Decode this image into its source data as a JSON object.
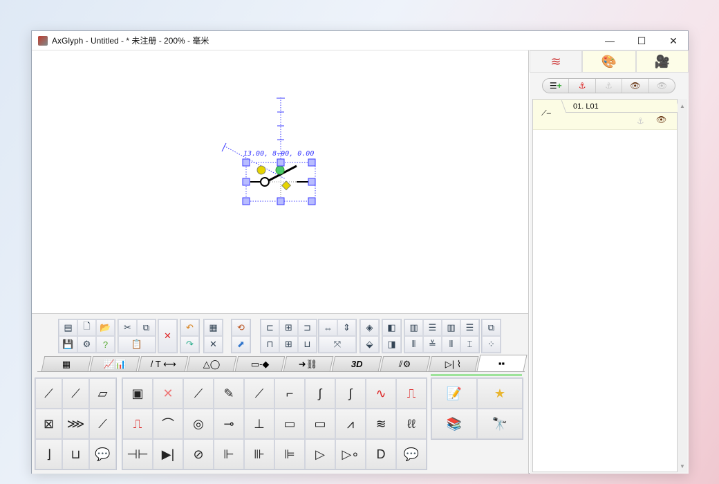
{
  "window": {
    "title": "AxGlyph - Untitled - * 未注册 - 200% - 毫米",
    "minimize": "—",
    "maximize": "☐",
    "close": "✕"
  },
  "canvas": {
    "coord_readout": "13.00, 8.00, 0.00"
  },
  "toolbar_groups": [
    {
      "cols": 3,
      "icons": [
        "view-options-icon",
        "new-document-icon",
        "open-folder-icon",
        "save-icon",
        "settings-gear-icon",
        "help-icon"
      ]
    },
    {
      "cols": 2,
      "icons": [
        "cut-icon",
        "copy-icon",
        "paste-icon"
      ]
    },
    {
      "cols": 1,
      "icons": [
        "delete-icon"
      ]
    },
    {
      "cols": 1,
      "icons": [
        "undo-icon",
        "redo-icon"
      ]
    },
    {
      "cols": 1,
      "icons": [
        "grid-snap-icon",
        "snap-point-icon"
      ]
    },
    {
      "cols": 1,
      "icons": [
        "rotate-icon",
        "flip-icon"
      ]
    },
    {
      "cols": 3,
      "icons": [
        "align-left-icon",
        "align-center-h-icon",
        "align-right-icon",
        "align-top-icon",
        "align-middle-v-icon",
        "align-bottom-icon"
      ]
    },
    {
      "cols": 2,
      "icons": [
        "same-width-icon",
        "same-height-icon",
        "same-size-icon"
      ]
    },
    {
      "cols": 1,
      "icons": [
        "mirror-h-icon",
        "mirror-v-icon"
      ]
    },
    {
      "cols": 1,
      "icons": [
        "bring-front-icon",
        "send-back-icon"
      ]
    },
    {
      "cols": 4,
      "icons": [
        "distribute-h-icon",
        "distribute-v-icon",
        "space-h-icon",
        "space-v-icon",
        "distribute-left-icon",
        "distribute-center-icon",
        "distribute-right-icon",
        "distribute-spacing-icon"
      ]
    },
    {
      "cols": 1,
      "icons": [
        "group-icon",
        "ungroup-icon"
      ]
    }
  ],
  "tabs": [
    {
      "icon": "color-palette-icon",
      "label": "▦"
    },
    {
      "icon": "chart-icon",
      "label": "📈📊"
    },
    {
      "icon": "line-text-dimension-icon",
      "label": "/ T ⟷"
    },
    {
      "icon": "shapes-icon",
      "label": "△◯"
    },
    {
      "icon": "flowchart-icon",
      "label": "▭-◆"
    },
    {
      "icon": "org-chart-icon",
      "label": "➜⛓"
    },
    {
      "icon": "3d-icon",
      "label": "3D"
    },
    {
      "icon": "electronics-icon",
      "label": "⫽⚙"
    },
    {
      "icon": "circuit-icon",
      "label": "▷| ⌇"
    },
    {
      "icon": "library-icon",
      "label": "▪▪"
    }
  ],
  "palette_left": [
    "pin-dot-icon",
    "line-endpoint-icon",
    "rectangle-tilted-icon",
    "checkbox-stack-icon",
    "resistor-spring-icon",
    "component-tilted-icon",
    "step-bracket-icon",
    "u-shape-icon",
    "comment-bubble-icon"
  ],
  "palette_main": [
    "select-group-icon",
    "delete-x-icon",
    "line-segment-icon",
    "pencil-line-icon",
    "straight-connector-icon",
    "elbow-connector-icon",
    "curved-connector-icon",
    "s-curve-connector-icon",
    "sine-wave-icon",
    "pulse-width-icon",
    "square-wave-icon",
    "jumper-crossover-icon",
    "coax-icon",
    "switch-icon",
    "push-button-icon",
    "fuse-icon",
    "resistor-box-icon",
    "resistor-zigzag-icon",
    "inductor-core-icon",
    "inductor-coil-icon",
    "capacitor-icon",
    "diode-icon",
    "transistor-icon",
    "mosfet-icon",
    "mosfet-diode-icon",
    "igbt-icon",
    "opamp-icon",
    "not-gate-icon",
    "and-gate-icon",
    "comment-bubble-icon"
  ],
  "palette_right": [
    "notepad-icon",
    "favorite-star-icon",
    "books-icon",
    "binoculars-icon"
  ],
  "side": {
    "tabs": [
      "layers-icon",
      "palette-brush-icon",
      "video-camera-icon"
    ],
    "layer_tools": [
      "add-layer-icon",
      "anchor-icon",
      "anchor-disabled-icon",
      "eye-icon",
      "eye-hidden-icon"
    ],
    "layers": [
      {
        "name": "01. L01"
      }
    ]
  },
  "colors": {
    "accent": "#3b3bff",
    "selection": "#aab0ff"
  }
}
